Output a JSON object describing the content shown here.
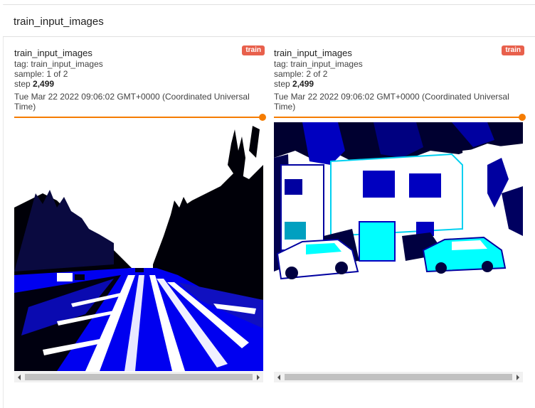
{
  "section": {
    "title": "train_input_images"
  },
  "cards": [
    {
      "title": "train_input_images",
      "run_badge": "train",
      "tag_label": "tag:",
      "tag_value": "train_input_images",
      "sample_label": "sample:",
      "sample_value": "1 of 2",
      "step_label": "step",
      "step_value": "2,499",
      "timestamp": "Tue Mar 22 2022 09:06:02 GMT+0000 (Coordinated Universal Time)",
      "slider_fraction": 1.0,
      "image_description_icon": "street-scene-image"
    },
    {
      "title": "train_input_images",
      "run_badge": "train",
      "tag_label": "tag:",
      "tag_value": "train_input_images",
      "sample_label": "sample:",
      "sample_value": "2 of 2",
      "step_label": "step",
      "step_value": "2,499",
      "timestamp": "Tue Mar 22 2022 09:06:02 GMT+0000 (Coordinated Universal Time)",
      "slider_fraction": 1.0,
      "image_description_icon": "house-scene-image"
    }
  ],
  "colors": {
    "accent": "#f57c00",
    "badge": "#e8604c",
    "image_blue": "#0000ff",
    "image_cyan": "#00ffff"
  }
}
